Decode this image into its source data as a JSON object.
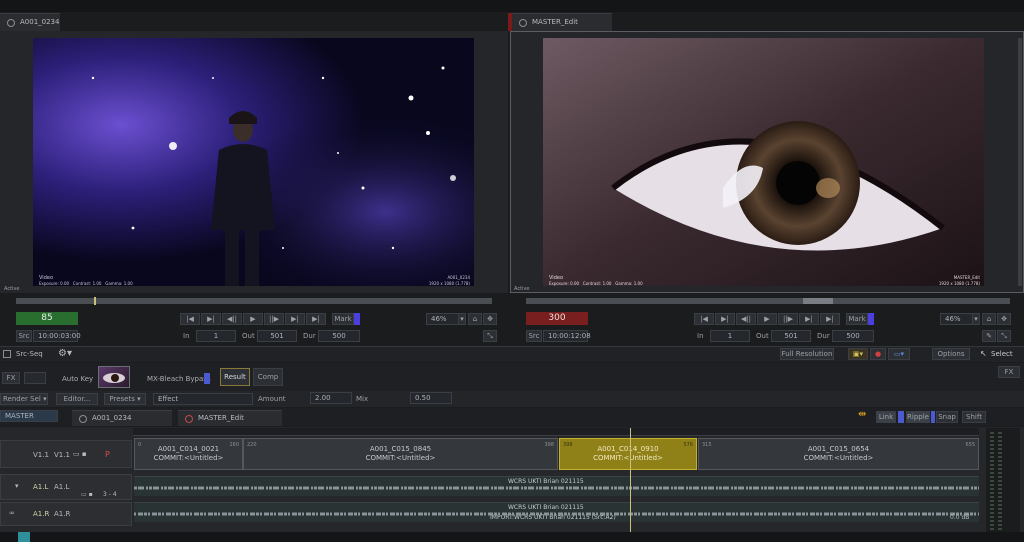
{
  "source": {
    "tab": "A001_0234",
    "status_left": "Active",
    "overlay_label": "Video",
    "overlay_info": "Exposure: 0.00   Contrast: 1.00   Gamma: 1.00",
    "overlay_right_top": "A001_0234",
    "overlay_right_bottom": "1920 x 1080 (1.778)",
    "counter": "85",
    "src_label": "Src",
    "timecode": "10:00:03:00",
    "mark_label": "Mark",
    "zoom": "46%",
    "in_label": "In",
    "in_value": "1",
    "out_label": "Out",
    "out_value": "501",
    "dur_label": "Dur",
    "dur_value": "500",
    "counter_color": "#2a6e2f"
  },
  "record": {
    "tab": "MASTER_Edit",
    "status_left": "Active",
    "overlay_label": "Video",
    "overlay_info": "Exposure: 0.00   Contrast: 1.00   Gamma: 1.00",
    "overlay_right_top": "MASTER_Edit",
    "overlay_right_bottom": "1920 x 1080 (1.778)",
    "counter": "300",
    "src_label": "Src",
    "timecode": "10:00:12:08",
    "mark_label": "Mark",
    "zoom": "46%",
    "in_label": "In",
    "in_value": "1",
    "out_label": "Out",
    "out_value": "501",
    "dur_label": "Dur",
    "dur_value": "500",
    "counter_color": "#7a1f1f"
  },
  "toolbar": {
    "mode": "Src-Seq",
    "resolution": "Full Resolution",
    "options": "Options",
    "select": "Select"
  },
  "fx": {
    "fx_label": "FX",
    "auto_key": "Auto Key",
    "effect_name": "MX-Bleach Bypass",
    "result_tab": "Result",
    "comp_tab": "Comp",
    "render_sel": "Render Sel",
    "editor": "Editor...",
    "presets": "Presets",
    "effect_field": "Effect",
    "amount_label": "Amount",
    "amount_value": "2.00",
    "mix_label": "Mix",
    "mix_value": "0.50",
    "corner_fx": "FX"
  },
  "timeline": {
    "master_label": "MASTER",
    "tabs": [
      "A001_0234",
      "MASTER_Edit"
    ],
    "link": "Link",
    "ripple": "Ripple",
    "snap": "Snap",
    "shift": "Shift",
    "tracks": {
      "v1": "V1.1",
      "v1b": "V1.1",
      "a1": "A1.L",
      "a1b": "A1.L",
      "a1r": "A1.R",
      "a1rb": "A1.R",
      "ch": "3 - 4"
    },
    "clips": [
      {
        "name": "A001_C014_0021",
        "sub": "COMMIT:<Untitled>",
        "tc_in": "0",
        "tc_out": "260"
      },
      {
        "name": "A001_C015_0845",
        "sub": "COMMIT:<Untitled>",
        "tc_in": "220",
        "tc_out": "398"
      },
      {
        "name": "A001_C014_0910",
        "sub": "COMMIT:<Untitled>",
        "tc_in": "398",
        "tc_out": "576"
      },
      {
        "name": "A001_C015_0654",
        "sub": "COMMIT:<Untitled>",
        "tc_in": "315",
        "tc_out": "655"
      }
    ],
    "audio1": "WCRS UKTI Brian 021115",
    "audio2": "WCRS UKTI Brian 021115",
    "audio2b": "IMPORT:WCRS UKTI Brian 021115 (Src:A2)",
    "db": "0.0 dB"
  }
}
